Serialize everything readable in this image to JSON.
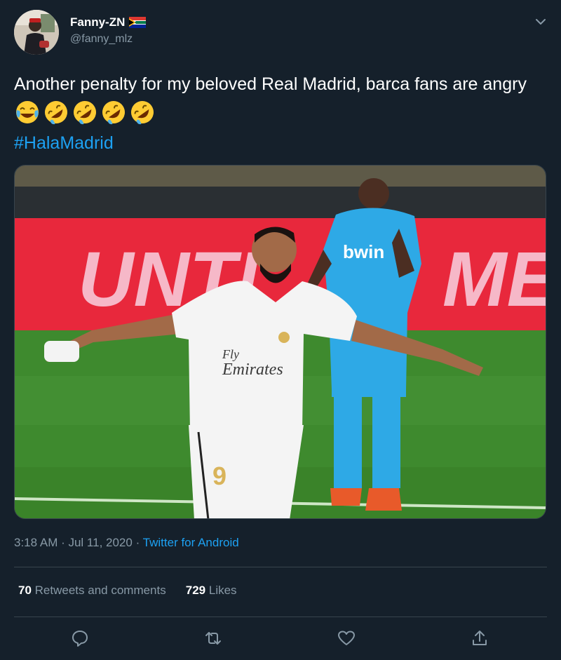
{
  "user": {
    "display_name": "Fanny-ZN",
    "handle": "@fanny_mlz",
    "flag_icon": "south-africa-flag-icon"
  },
  "tweet": {
    "text": "Another penalty for my beloved Real Madrid, barca fans are angry",
    "emojis": [
      "face-with-tears-of-joy-emoji",
      "rolling-on-the-floor-laughing-emoji",
      "rolling-on-the-floor-laughing-emoji",
      "rolling-on-the-floor-laughing-emoji",
      "rolling-on-the-floor-laughing-emoji"
    ],
    "hashtag": "#HalaMadrid"
  },
  "media": {
    "banner_left": "UNTI",
    "banner_right": "ME",
    "jersey_sponsor_left": "bwin",
    "jersey_sponsor_right_line1": "Fly",
    "jersey_sponsor_right_line2": "Emirates",
    "shirt_number": "9"
  },
  "meta": {
    "timestamp": "3:18 AM · Jul 11, 2020",
    "separator": " · ",
    "source": "Twitter for Android"
  },
  "stats": {
    "retweets_count": "70",
    "retweets_label": "Retweets and comments",
    "likes_count": "729",
    "likes_label": "Likes"
  },
  "actions": [
    "reply-icon",
    "retweet-icon",
    "like-icon",
    "share-icon"
  ],
  "colors": {
    "background": "#15202b",
    "accent": "#1da1f2",
    "muted": "#8899a6",
    "divider": "#38444d"
  }
}
